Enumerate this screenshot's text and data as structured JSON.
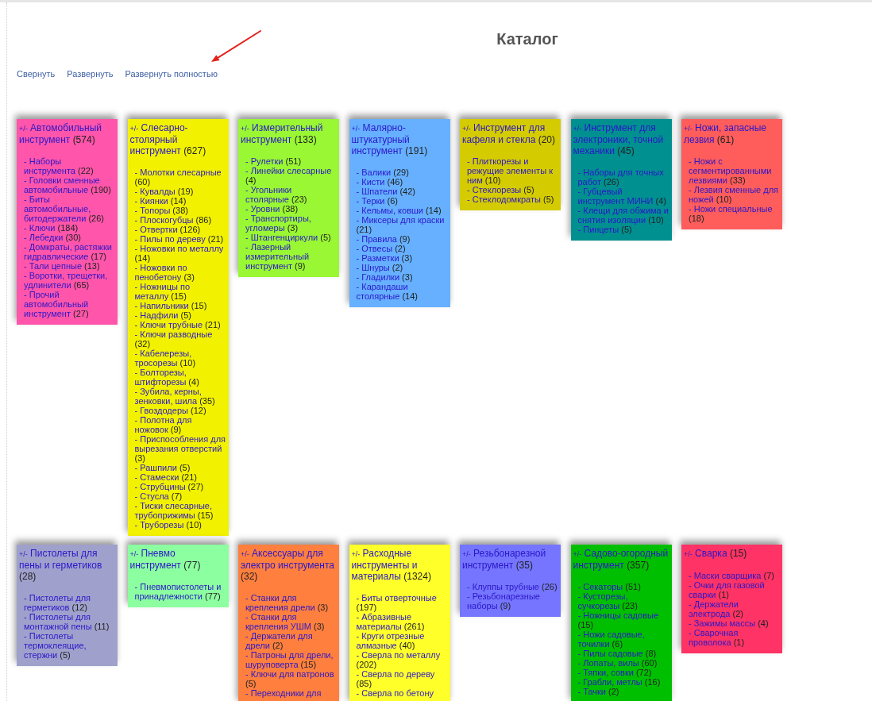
{
  "page": {
    "title": "Каталог"
  },
  "actions": [
    "Свернуть",
    "Развернуть",
    "Развернуть полностью"
  ],
  "categories": [
    {
      "toggle": "+/-",
      "name": "Автомобильный инструмент",
      "count": "(574)",
      "color": "#ff55aa",
      "items": [
        {
          "name": "- Наборы инструмента",
          "count": "(22)"
        },
        {
          "name": "- Головки сменные автомобильные",
          "count": "(190)"
        },
        {
          "name": "- Биты автомобильные, битодержатели",
          "count": "(26)"
        },
        {
          "name": "- Ключи",
          "count": "(184)"
        },
        {
          "name": "- Лебедки",
          "count": "(30)"
        },
        {
          "name": "- Домкраты, растяжки гидравлические",
          "count": "(17)"
        },
        {
          "name": "- Тали цепные",
          "count": "(13)"
        },
        {
          "name": "- Воротки, трещетки, удлинители",
          "count": "(65)"
        },
        {
          "name": "- Прочий автомобильный инструмент",
          "count": "(27)"
        }
      ]
    },
    {
      "toggle": "+/-",
      "name": "Слесарно-столярный инструмент",
      "count": "(627)",
      "color": "#f2f200",
      "items": [
        {
          "name": "- Молотки слесарные",
          "count": "(60)"
        },
        {
          "name": "- Кувалды",
          "count": "(19)"
        },
        {
          "name": "- Киянки",
          "count": "(14)"
        },
        {
          "name": "- Топоры",
          "count": "(38)"
        },
        {
          "name": "- Плоскогубцы",
          "count": "(86)"
        },
        {
          "name": "- Отвертки",
          "count": "(126)"
        },
        {
          "name": "- Пилы по дереву",
          "count": "(21)"
        },
        {
          "name": "- Ножовки по металлу",
          "count": "(14)"
        },
        {
          "name": "- Ножовки по пенобетону",
          "count": "(3)"
        },
        {
          "name": "- Ножницы по металлу",
          "count": "(15)"
        },
        {
          "name": "- Напильники",
          "count": "(15)"
        },
        {
          "name": "- Надфили",
          "count": "(5)"
        },
        {
          "name": "- Ключи трубные",
          "count": "(21)"
        },
        {
          "name": "- Ключи разводные",
          "count": "(32)"
        },
        {
          "name": "- Кабелерезы, тросорезы",
          "count": "(10)"
        },
        {
          "name": "- Болторезы, штифторезы",
          "count": "(4)"
        },
        {
          "name": "- Зубила, керны, зенковки, шила",
          "count": "(35)"
        },
        {
          "name": "- Гвоздодеры",
          "count": "(12)"
        },
        {
          "name": "- Полотна для ножовок",
          "count": "(9)"
        },
        {
          "name": "- Приспособления для вырезания отверстий",
          "count": "(3)"
        },
        {
          "name": "- Рашпили",
          "count": "(5)"
        },
        {
          "name": "- Стамески",
          "count": "(21)"
        },
        {
          "name": "- Струбцины",
          "count": "(27)"
        },
        {
          "name": "- Стусла",
          "count": "(7)"
        },
        {
          "name": "- Тиски слесарные, трубоприжимы",
          "count": "(15)"
        },
        {
          "name": "- Труборезы",
          "count": "(10)"
        }
      ]
    },
    {
      "toggle": "+/-",
      "name": "Измерительный инструмент",
      "count": "(133)",
      "color": "#99f733",
      "items": [
        {
          "name": "- Рулетки",
          "count": "(51)"
        },
        {
          "name": "- Линейки слесарные",
          "count": "(4)"
        },
        {
          "name": "- Угольники столярные",
          "count": "(23)"
        },
        {
          "name": "- Уровни",
          "count": "(38)"
        },
        {
          "name": "- Транспортиры, угломеры",
          "count": "(3)"
        },
        {
          "name": "- Штангенциркули",
          "count": "(5)"
        },
        {
          "name": "- Лазерный измерительный инструмент",
          "count": "(9)"
        }
      ]
    },
    {
      "toggle": "+/-",
      "name": "Малярно-штукатурный инструмент",
      "count": "(191)",
      "color": "#66b0ff",
      "items": [
        {
          "name": "- Валики",
          "count": "(29)"
        },
        {
          "name": "- Кисти",
          "count": "(46)"
        },
        {
          "name": "- Шпатели",
          "count": "(42)"
        },
        {
          "name": "- Терки",
          "count": "(6)"
        },
        {
          "name": "- Кельмы, ковши",
          "count": "(14)"
        },
        {
          "name": "- Миксеры для краски",
          "count": "(21)"
        },
        {
          "name": "- Правила",
          "count": "(9)"
        },
        {
          "name": "- Отвесы",
          "count": "(2)"
        },
        {
          "name": "- Разметки",
          "count": "(3)"
        },
        {
          "name": "- Шнуры",
          "count": "(2)"
        },
        {
          "name": "- Гладилки",
          "count": "(3)"
        },
        {
          "name": "- Карандаши столярные",
          "count": "(14)"
        }
      ]
    },
    {
      "toggle": "+/-",
      "name": "Инструмент для кафеля и стекла",
      "count": "(20)",
      "color": "#d4cc00",
      "items": [
        {
          "name": "- Плиткорезы и режущие элементы к ним",
          "count": "(10)"
        },
        {
          "name": "- Стеклорезы",
          "count": "(5)"
        },
        {
          "name": "- Стеклодомкраты",
          "count": "(5)"
        }
      ]
    },
    {
      "toggle": "+/-",
      "name": "Инструмент для электроники, точной механики",
      "count": "(45)",
      "color": "#009090",
      "items": [
        {
          "name": "- Наборы для точных работ",
          "count": "(26)"
        },
        {
          "name": "- Губцевый инструмент МИНИ",
          "count": "(4)"
        },
        {
          "name": "- Клещи для обжима и снятия изоляции",
          "count": "(10)"
        },
        {
          "name": "- Пинцеты",
          "count": "(5)"
        }
      ]
    },
    {
      "toggle": "+/-",
      "name": "Ножи, запасные лезвия",
      "count": "(61)",
      "color": "#ff5c5c",
      "items": [
        {
          "name": "- Ножи с сегментированными лезвиями",
          "count": "(33)"
        },
        {
          "name": "- Лезвия сменные для ножей",
          "count": "(10)"
        },
        {
          "name": "- Ножи специальные",
          "count": "(18)"
        }
      ]
    },
    {
      "toggle": "+/-",
      "name": "Пистолеты для пены и герметиков",
      "count": "(28)",
      "color": "#a0a0cc",
      "items": [
        {
          "name": "- Пистолеты для герметиков",
          "count": "(12)"
        },
        {
          "name": "- Пистолеты для монтажной пены",
          "count": "(11)"
        },
        {
          "name": "- Пистолеты термоклеящие, стержни",
          "count": "(5)"
        }
      ]
    },
    {
      "toggle": "+/-",
      "name": "Пневмо инструмент",
      "count": "(77)",
      "color": "#8cffa0",
      "items": [
        {
          "name": "- Пневмопистолеты и принадлежности",
          "count": "(77)"
        }
      ]
    },
    {
      "toggle": "+/-",
      "name": "Аксессуары для электро инструмента",
      "count": "(32)",
      "color": "#ff7f3f",
      "items": [
        {
          "name": "- Станки для крепления дрели",
          "count": "(3)"
        },
        {
          "name": "- Станки для крепления УШМ",
          "count": "(3)"
        },
        {
          "name": "- Держатели для дрели",
          "count": "(2)"
        },
        {
          "name": "- Патроны для дрели, шуруповерта",
          "count": "(15)"
        },
        {
          "name": "- Ключи для патронов",
          "count": "(5)"
        },
        {
          "name": "- Переходники для"
        }
      ]
    },
    {
      "toggle": "+/-",
      "name": "Расходные инструменты и материалы",
      "count": "(1324)",
      "color": "#ffff2a",
      "items": [
        {
          "name": "- Биты отверточные",
          "count": "(197)"
        },
        {
          "name": "- Абразивные материалы",
          "count": "(261)"
        },
        {
          "name": "- Круги отрезные алмазные",
          "count": "(40)"
        },
        {
          "name": "- Сверла по металлу",
          "count": "(202)"
        },
        {
          "name": "- Сверла по дереву",
          "count": "(85)"
        },
        {
          "name": "- Сверла по бетону"
        }
      ]
    },
    {
      "toggle": "+/-",
      "name": "Резьбонарезной инструмент",
      "count": "(35)",
      "color": "#7575ff",
      "items": [
        {
          "name": "- Клуппы трубные",
          "count": "(26)"
        },
        {
          "name": "- Резьбонарезные наборы",
          "count": "(9)"
        }
      ]
    },
    {
      "toggle": "+/-",
      "name": "Садово-огородный инструмент",
      "count": "(357)",
      "color": "#00bf00",
      "items": [
        {
          "name": "- Секаторы",
          "count": "(51)"
        },
        {
          "name": "- Кусторезы, сучкорезы",
          "count": "(23)"
        },
        {
          "name": "- Ножницы садовые",
          "count": "(15)"
        },
        {
          "name": "- Ножи садовые, точилки",
          "count": "(6)"
        },
        {
          "name": "- Пилы садовые",
          "count": "(8)"
        },
        {
          "name": "- Лопаты, вилы",
          "count": "(60)"
        },
        {
          "name": "- Тяпки, совки",
          "count": "(72)"
        },
        {
          "name": "- Грабли, метлы",
          "count": "(16)"
        },
        {
          "name": "- Тачки",
          "count": "(2)"
        }
      ]
    },
    {
      "toggle": "+/-",
      "name": "Сварка",
      "count": "(15)",
      "color": "#ff3366",
      "items": [
        {
          "name": "- Маски сварщика",
          "count": "(7)"
        },
        {
          "name": "- Очки для газовой сварки",
          "count": "(1)"
        },
        {
          "name": "- Держатели электрода",
          "count": "(2)"
        },
        {
          "name": "- Зажимы массы",
          "count": "(4)"
        },
        {
          "name": "- Сварочная проволока",
          "count": "(1)"
        }
      ]
    }
  ]
}
